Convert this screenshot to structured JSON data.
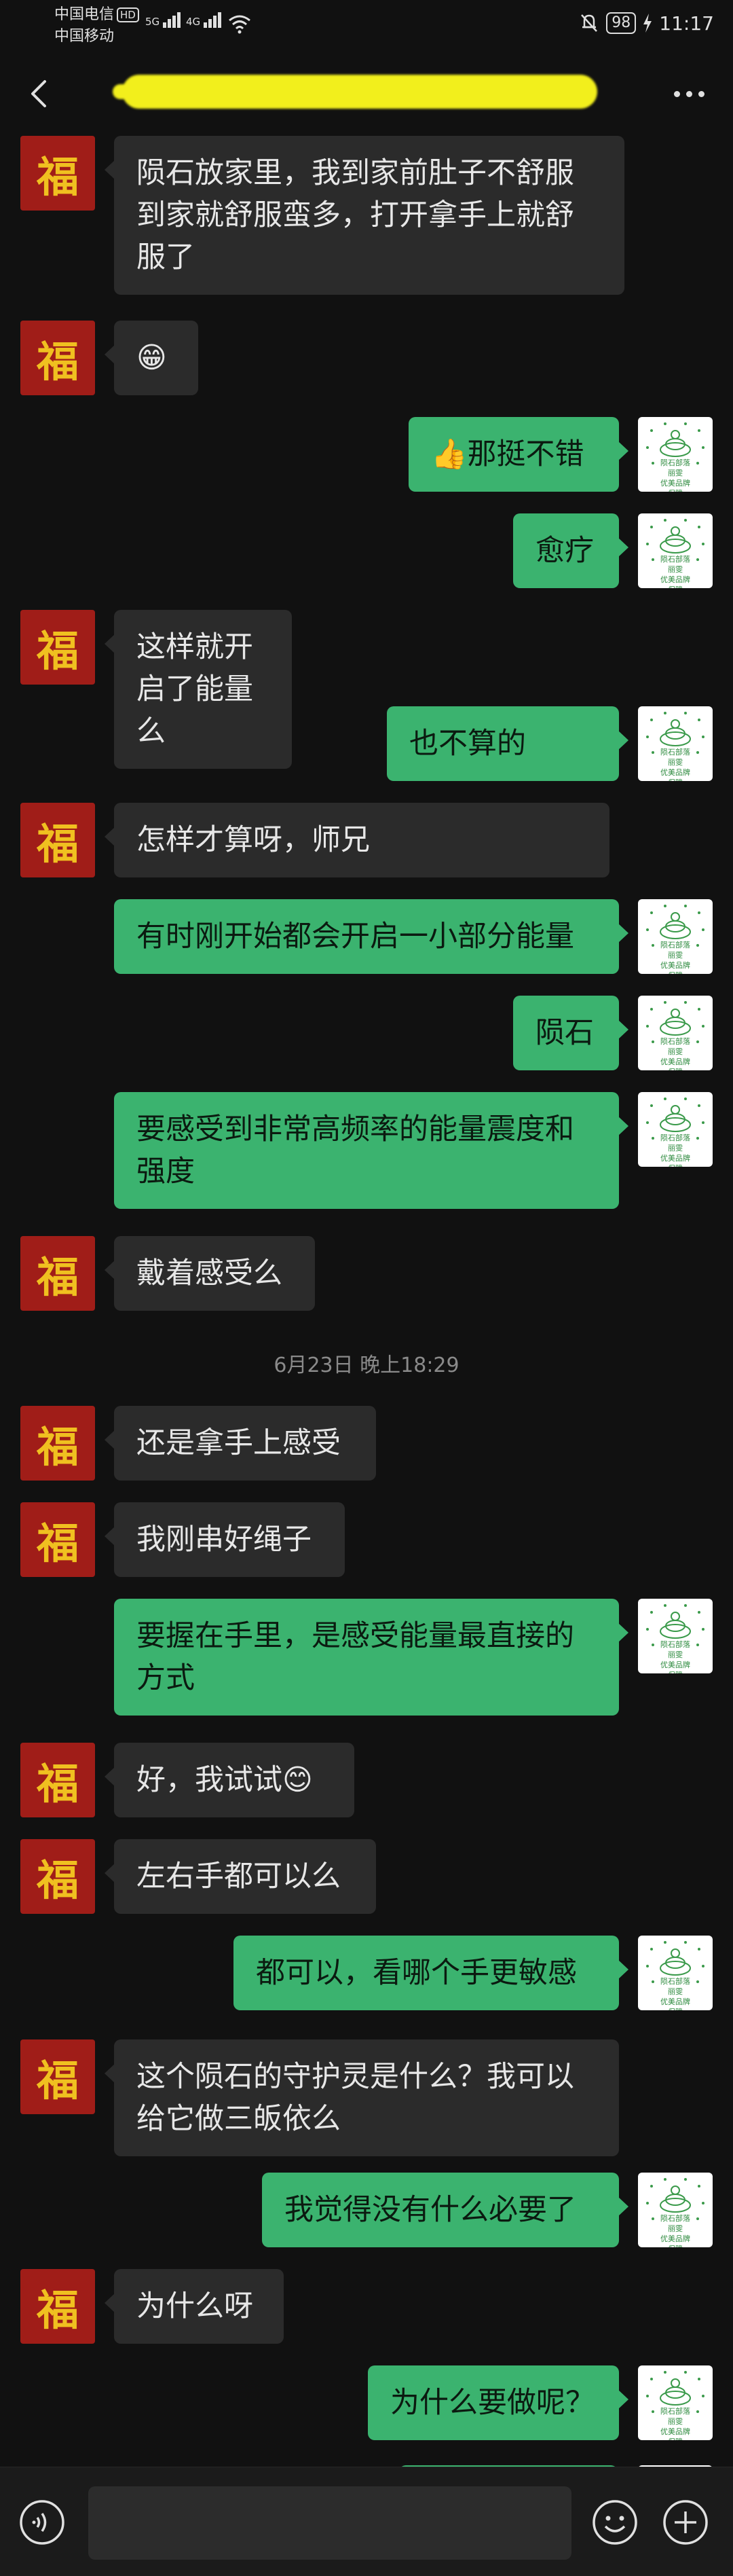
{
  "status_bar": {
    "carrier1": "中国电信",
    "hd": "HD",
    "net1": "5G",
    "carrier2": "中国移动",
    "net2": "4G",
    "battery": "98",
    "time": "11:17"
  },
  "header": {
    "title_redacted": true
  },
  "contact": {
    "avatar_char": "福"
  },
  "me": {
    "avatar_text_lines": [
      "陨石部落",
      "丽雯",
      "优美品牌",
      "保障"
    ]
  },
  "messages": [
    {
      "side": "in",
      "text": "陨石放家里，我到家前肚子不舒服到家就舒服蛮多，打开拿手上就舒服了"
    },
    {
      "side": "in",
      "text": "😁"
    },
    {
      "side": "out",
      "text": "👍那挺不错"
    },
    {
      "side": "out",
      "text": "愈疗"
    },
    {
      "side": "in",
      "text": "这样就开启了能量么"
    },
    {
      "side": "out",
      "text": "也不算的"
    },
    {
      "side": "in",
      "text": "怎样才算呀，师兄"
    },
    {
      "side": "out",
      "text": "有时刚开始都会开启一小部分能量"
    },
    {
      "side": "out",
      "text": "陨石"
    },
    {
      "side": "out",
      "text": "要感受到非常高频率的能量震度和强度"
    },
    {
      "side": "in",
      "text": "戴着感受么"
    },
    {
      "side": "in",
      "text": "还是拿手上感受"
    },
    {
      "side": "in",
      "text": "我刚串好绳子"
    },
    {
      "side": "out",
      "text": "要握在手里，是感受能量最直接的方式"
    },
    {
      "side": "in",
      "text": "好，我试试😊"
    },
    {
      "side": "in",
      "text": "左右手都可以么"
    },
    {
      "side": "out",
      "text": "都可以，看哪个手更敏感"
    },
    {
      "side": "in",
      "text": "这个陨石的守护灵是什么？我可以给它做三皈依么"
    },
    {
      "side": "out",
      "text": "我觉得没有什么必要了"
    },
    {
      "side": "in",
      "text": "为什么呀"
    },
    {
      "side": "out",
      "text": "为什么要做呢？"
    }
  ],
  "timestamp": "6月23日 晚上18:29",
  "input": {
    "value": ""
  },
  "colors": {
    "background": "#111111",
    "incoming": "#2b2b2b",
    "outgoing": "#3bb36f",
    "avatar_red": "#a01d18",
    "avatar_gold": "#f0c020"
  }
}
